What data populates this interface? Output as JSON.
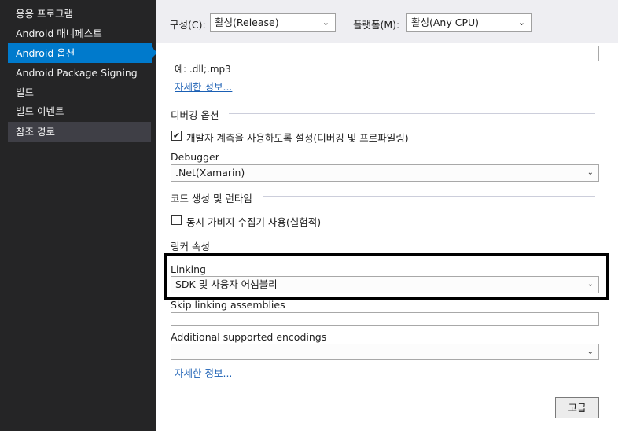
{
  "sidebar": {
    "items": [
      {
        "label": "응용 프로그램"
      },
      {
        "label": "Android 매니페스트"
      },
      {
        "label": "Android 옵션"
      },
      {
        "label": "Android Package Signing"
      },
      {
        "label": "빌드"
      },
      {
        "label": "빌드 이벤트"
      },
      {
        "label": "참조 경로"
      }
    ]
  },
  "topbar": {
    "config_label": "구성(C):",
    "config_value": "활성(Release)",
    "platform_label": "플랫폼(M):",
    "platform_value": "활성(Any CPU)"
  },
  "compression": {
    "example": "예: .dll;.mp3",
    "details_link": "자세한 정보..."
  },
  "debugging": {
    "heading": "디버깅 옵션",
    "dev_instrumentation_label": "개발자 계측을 사용하도록 설정(디버깅 및 프로파일링)",
    "dev_instrumentation_checked": true,
    "debugger_label": "Debugger",
    "debugger_value": ".Net(Xamarin)"
  },
  "codegen": {
    "heading": "코드 생성 및 런타임",
    "concurrent_gc_label": "동시 가비지 수집기 사용(실험적)",
    "concurrent_gc_checked": false
  },
  "linker": {
    "heading": "링커 속성",
    "linking_label": "Linking",
    "linking_value": "SDK 및 사용자 어셈블리",
    "skip_label": "Skip linking assemblies",
    "skip_value": "",
    "encodings_label": "Additional supported encodings",
    "encodings_value": "",
    "details_link": "자세한 정보..."
  },
  "footer": {
    "advanced_button": "고급"
  },
  "icons": {
    "chevron": "chevron-down-icon",
    "check": "checkmark-icon",
    "pointer": "active-arrow"
  },
  "colors": {
    "sidebar_bg": "#252526",
    "active_bg": "#007acc",
    "selected_bg": "#3f3f46",
    "link": "#1a5fb4",
    "highlight_border": "#000000"
  }
}
